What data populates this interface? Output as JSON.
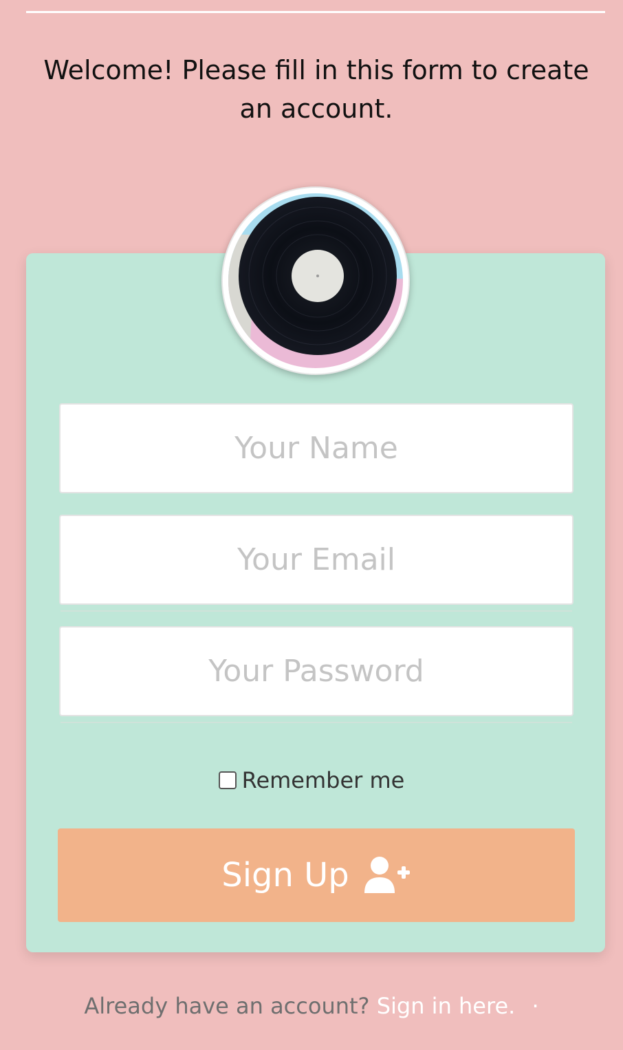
{
  "header": {
    "welcome_text": "Welcome! Please fill in this form to create an account."
  },
  "form": {
    "name_placeholder": "Your Name",
    "email_placeholder": "Your Email",
    "password_placeholder": "Your Password",
    "remember_label": "Remember me",
    "remember_checked": false,
    "signup_label": "Sign Up"
  },
  "footer": {
    "prompt": "Already have an account?",
    "signin_link": "Sign in here.",
    "separator": "·"
  },
  "icons": {
    "avatar": "vinyl-record-icon",
    "signup": "user-plus-icon"
  },
  "colors": {
    "background": "#f0bebd",
    "card": "#bfe7d8",
    "button": "#f2b38a"
  }
}
